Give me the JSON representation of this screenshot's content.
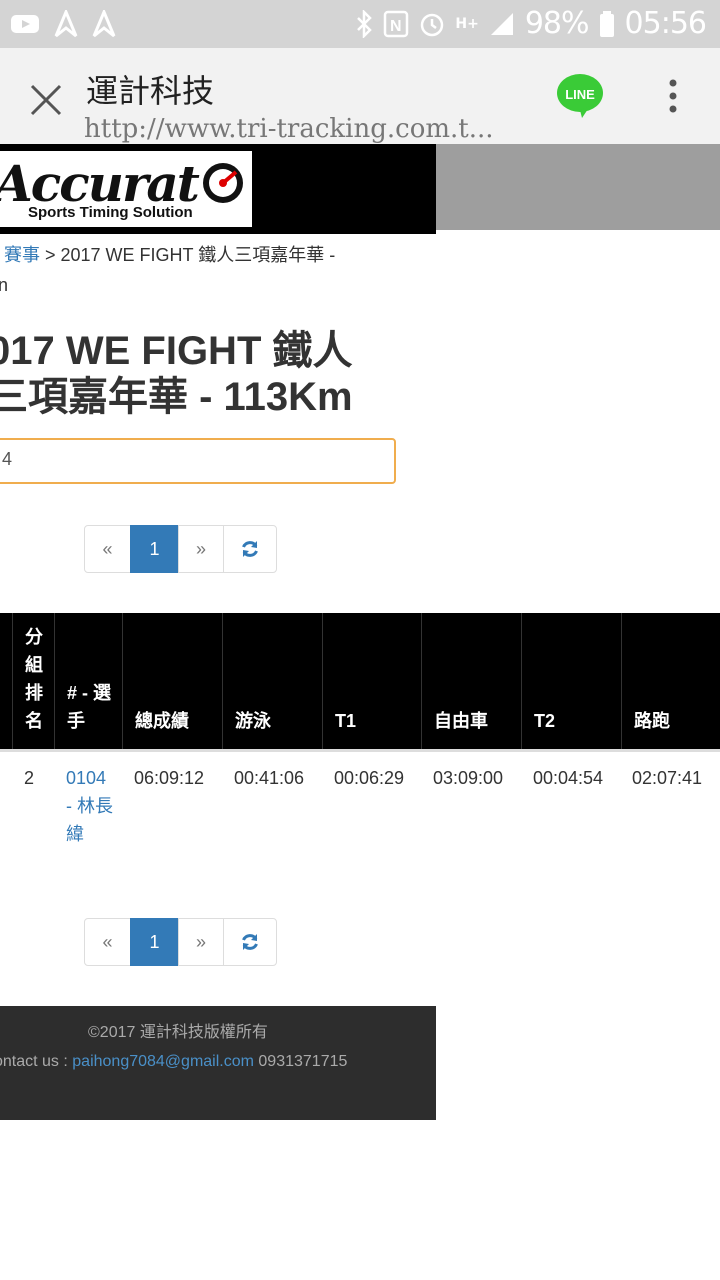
{
  "status_bar": {
    "battery_pct": "98%",
    "time": "05:56",
    "network": "H+"
  },
  "browser": {
    "title": "運計科技",
    "url": "http://www.tri-tracking.com.t...",
    "line_label": "LINE"
  },
  "logo": {
    "word": "Accurat",
    "tagline": "Sports Timing Solution"
  },
  "breadcrumb": {
    "link": "賽事",
    "text": " > 2017 WE FIGHT 鐵人三項嘉年華 -",
    "line2": "n"
  },
  "page": {
    "title_line1": "017 WE FIGHT 鐵人",
    "title_line2": "三項嘉年華 - 113Km"
  },
  "search": {
    "value": "4"
  },
  "pagination": {
    "prev": "«",
    "current": "1",
    "next": "»",
    "refresh_icon": "refresh-icon"
  },
  "table": {
    "headers": [
      "分組排名",
      "# - 選手",
      "總成績",
      "游泳",
      "T1",
      "自由車",
      "T2",
      "路跑"
    ],
    "rows": [
      {
        "rank": "2",
        "athlete_no": "0104",
        "athlete_name": "- 林長緯",
        "total": "06:09:12",
        "swim": "00:41:06",
        "t1": "00:06:29",
        "bike": "03:09:00",
        "t2": "00:04:54",
        "run": "02:07:41"
      }
    ]
  },
  "footer": {
    "copyright": "©2017 運計科技版權所有",
    "contact_label": "ontact us : ",
    "email": "paihong7084@gmail.com",
    "phone": " 0931371715"
  },
  "colors": {
    "link": "#337ab7",
    "header_bg": "#000000",
    "footer_bg": "#2d2d2d",
    "search_border": "#f0ad4e"
  }
}
